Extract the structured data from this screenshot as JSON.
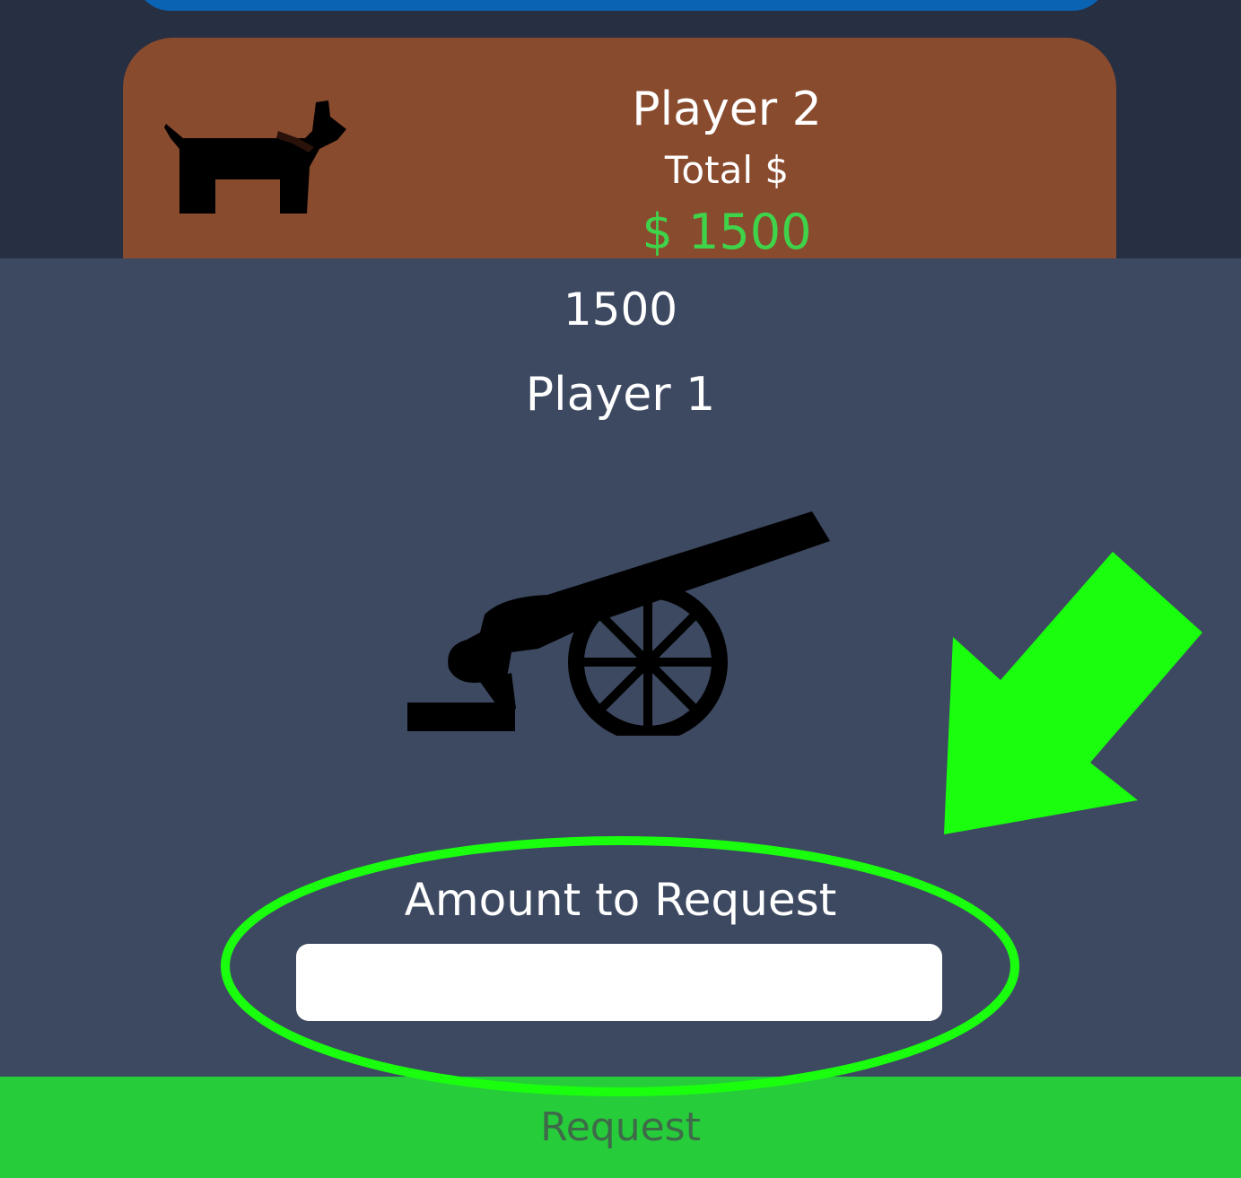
{
  "player_card": {
    "name": "Player 2",
    "total_label": "Total $",
    "balance": "$ 1500",
    "icon": "dog-icon",
    "colors": {
      "card": "#894b2e",
      "balance": "#3fd34a"
    }
  },
  "sheet": {
    "amount": "1500",
    "player_name": "Player 1",
    "icon": "cannon-icon",
    "amount_label": "Amount to Request",
    "amount_input_value": "",
    "colors": {
      "background": "#3d4961"
    }
  },
  "request_button": {
    "label": "Request",
    "color": "#27cc3a"
  },
  "annotation": {
    "highlight_color": "#19ff0d",
    "shapes": [
      "ellipse",
      "arrow"
    ]
  }
}
